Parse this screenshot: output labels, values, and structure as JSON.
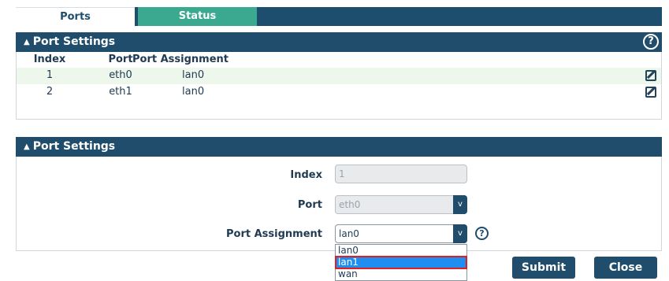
{
  "tabs": [
    {
      "label": "Ports",
      "active": true
    },
    {
      "label": "Status",
      "active": false
    }
  ],
  "port_table_panel": {
    "title": "Port Settings",
    "columns": [
      "Index",
      "Port",
      "Port Assignment"
    ],
    "rows": [
      {
        "index": "1",
        "port": "eth0",
        "assignment": "lan0"
      },
      {
        "index": "2",
        "port": "eth1",
        "assignment": "lan0"
      }
    ]
  },
  "edit_panel": {
    "title": "Port Settings",
    "index_label": "Index",
    "index_value": "1",
    "port_label": "Port",
    "port_value": "eth0",
    "assignment_label": "Port Assignment",
    "assignment_value": "lan0",
    "assignment_options": [
      "lan0",
      "lan1",
      "wan"
    ],
    "highlighted_option": "lan1"
  },
  "buttons": {
    "submit_label": "Submit",
    "close_label": "Close"
  },
  "colors": {
    "header": "#1f4d6b",
    "status_tab": "#3aa98f",
    "highlight": "#1e8ff0",
    "outline": "#e02020"
  }
}
